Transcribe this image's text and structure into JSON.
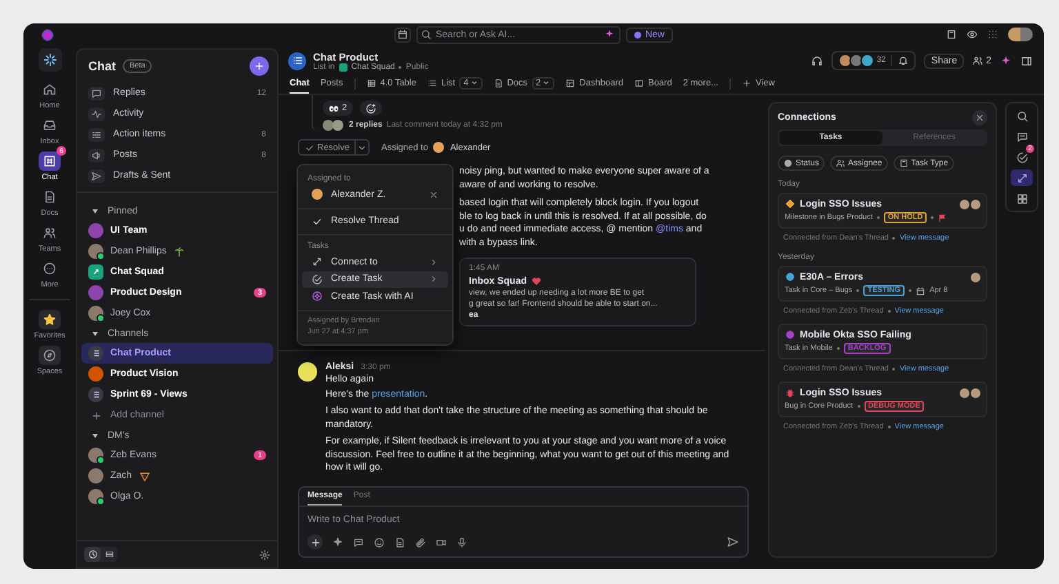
{
  "topbar": {
    "search": {
      "placeholder": "Search or Ask AI..."
    },
    "new_button": "New"
  },
  "rail": {
    "items": [
      {
        "label": "Home",
        "kind": "home",
        "selected": false
      },
      {
        "label": "Inbox",
        "kind": "inbox",
        "selected": false
      },
      {
        "label": "Chat",
        "kind": "chat",
        "selected": true,
        "badge": "6"
      },
      {
        "label": "Docs",
        "kind": "doc",
        "selected": false
      },
      {
        "label": "Teams",
        "kind": "teams",
        "selected": false
      },
      {
        "label": "More",
        "kind": "more",
        "selected": false
      }
    ],
    "bottom_items": [
      {
        "label": "Favorites",
        "kind": "star"
      },
      {
        "label": "Spaces",
        "kind": "compass"
      }
    ]
  },
  "sidebar": {
    "title": "Chat",
    "tag": "Beta",
    "nav": [
      {
        "label": "Replies",
        "kind": "replies",
        "count": "12"
      },
      {
        "label": "Activity",
        "kind": "activity"
      },
      {
        "label": "Action items",
        "kind": "action",
        "count": "8"
      },
      {
        "label": "Posts",
        "kind": "posts",
        "count": "8"
      },
      {
        "label": "Drafts & Sent",
        "kind": "drafts"
      }
    ],
    "sections": [
      {
        "title": "Pinned",
        "expanded": true,
        "items": [
          {
            "label": "UI Team",
            "kind": "team",
            "unread": true,
            "selected": false
          },
          {
            "label": "Dean Phillips",
            "kind": "person",
            "unread": false,
            "online": true,
            "selected": false,
            "status_emoji": {
              "kind": "palm"
            }
          },
          {
            "label": "Chat Squad",
            "kind": "space",
            "unread": true,
            "selected": false
          },
          {
            "label": "Product Design",
            "kind": "team",
            "unread": true,
            "selected": false,
            "badge": "3"
          },
          {
            "label": "Joey Cox",
            "kind": "person",
            "unread": false,
            "online": true,
            "selected": false
          }
        ]
      },
      {
        "title": "Channels",
        "expanded": true,
        "add_label": "Add channel",
        "items": [
          {
            "label": "Chat Product",
            "kind": "channel",
            "unread": true,
            "selected": true
          },
          {
            "label": "Product Vision",
            "kind": "team",
            "unread": true,
            "selected": false
          },
          {
            "label": "Sprint 69 - Views",
            "kind": "channel",
            "unread": true,
            "selected": false
          }
        ]
      },
      {
        "title": "DM's",
        "expanded": true,
        "items": [
          {
            "label": "Zeb Evans",
            "kind": "person",
            "unread": false,
            "online": true,
            "selected": false,
            "badge": "1"
          },
          {
            "label": "Zach",
            "kind": "person",
            "unread": false,
            "online": false,
            "selected": false,
            "status_emoji": {
              "kind": "pizza"
            }
          },
          {
            "label": "Olga O.",
            "kind": "person",
            "unread": false,
            "online": true,
            "selected": false
          }
        ]
      }
    ]
  },
  "header": {
    "title": "Chat Product",
    "location_prefix": "List in",
    "location": "Chat Squad",
    "visibility": "Public",
    "member_count": "32",
    "share": "Share",
    "watchers": "2",
    "tabs": [
      {
        "label": "Chat",
        "kind": "text",
        "selected": true
      },
      {
        "label": "Posts",
        "kind": "text",
        "selected": false
      },
      {
        "label": "4.0 Table",
        "kind": "table",
        "selected": false
      },
      {
        "label": "List",
        "kind": "list",
        "count": "4",
        "selected": false
      },
      {
        "label": "Docs",
        "kind": "doc",
        "count": "2",
        "selected": false
      },
      {
        "label": "Dashboard",
        "kind": "dashboard",
        "selected": false
      },
      {
        "label": "Board",
        "kind": "board",
        "selected": false
      },
      {
        "label": "2 more...",
        "kind": "text",
        "selected": false
      }
    ],
    "add_view": "View"
  },
  "thread": {
    "reactions": [
      {
        "kind": "eyes",
        "count": "2"
      }
    ],
    "replies": "2 replies",
    "last_comment": "Last comment today at 4:32 pm",
    "resolve": "Resolve",
    "assigned_label": "Assigned to",
    "assignee": "Alexander",
    "paragraphs": [
      [
        [
          {
            "kind": "text",
            "text": "noisy ping, but wanted to make everyone super aware of a"
          }
        ],
        [
          {
            "kind": "text",
            "text": "aware of and working to resolve."
          }
        ]
      ],
      [
        [
          {
            "kind": "text",
            "text": "based login that will completely block login. If you logout"
          }
        ],
        [
          {
            "kind": "text",
            "text": "ble to log back in until this is resolved. If at all possible, do"
          }
        ],
        [
          {
            "kind": "text",
            "text": "u do and need immediate access, @ mention "
          },
          {
            "kind": "mention",
            "text": "@tims"
          },
          {
            "kind": "text",
            "text": " and"
          }
        ],
        [
          {
            "kind": "text",
            "text": "with a bypass link."
          }
        ]
      ]
    ],
    "quote": {
      "time": "1:45 AM",
      "title": "Inbox Squad",
      "lines": [
        "view, we ended up needing a lot more BE to get",
        "g great so far! Frontend should be able to start on..."
      ],
      "footer": "ea"
    }
  },
  "menu": {
    "assigned_heading": "Assigned to",
    "assignee": "Alexander Z.",
    "resolve": "Resolve Thread",
    "tasks_heading": "Tasks",
    "items": [
      {
        "label": "Connect to",
        "kind": "connect",
        "submenu": true,
        "selected": false
      },
      {
        "label": "Create Task",
        "kind": "task",
        "submenu": true,
        "selected": true
      },
      {
        "label": "Create Task with AI",
        "kind": "ai",
        "submenu": false,
        "selected": false
      }
    ],
    "assigned_by": "Assigned by Brendan",
    "assigned_at": "Jun 27 at 4:37 pm"
  },
  "message": {
    "author": "Aleksi",
    "time": "3:30 pm",
    "greeting": "Hello again",
    "link_before": "Here's the ",
    "link": "presentation",
    "link_after": ".",
    "paragraphs": [
      "I also want to add that don't take the structure of the meeting as something that should be mandatory.",
      "For example, if Silent feedback is irrelevant to you at your stage and you want more of a voice discussion. Feel free to outline it at the beginning, what you want to get out of this meeting and how it will go."
    ]
  },
  "composer": {
    "tabs": [
      {
        "label": "Message",
        "selected": true
      },
      {
        "label": "Post",
        "selected": false
      }
    ],
    "placeholder": "Write to Chat Product"
  },
  "connections": {
    "title": "Connections",
    "tabs": [
      {
        "label": "Tasks",
        "selected": true
      },
      {
        "label": "References",
        "selected": false
      }
    ],
    "filters": [
      {
        "label": "Status",
        "kind": "status"
      },
      {
        "label": "Assignee",
        "kind": "assignee"
      },
      {
        "label": "Task Type",
        "kind": "type"
      }
    ],
    "groups": [
      {
        "title": "Today",
        "cards": [
          {
            "title": "Login SSO Issues",
            "kind": "milestone",
            "subtitle": "Milestone in Bugs Product",
            "status": "ON HOLD",
            "color": "#e0a33a",
            "flag": true,
            "avatars": [
              {
                "kind": "photo"
              },
              {
                "kind": "photo"
              }
            ],
            "source": "Connected from Dean's Thread",
            "link": "View message"
          }
        ]
      },
      {
        "title": "Yesterday",
        "cards": [
          {
            "title": "E30A – Errors",
            "kind": "task",
            "subtitle": "Task in Core – Bugs",
            "status": "TESTING",
            "color": "#4aa3d8",
            "flag": false,
            "date": "Apr 8",
            "avatars": [
              {
                "kind": "photo"
              }
            ],
            "source": "Connected from Zeb's Thread",
            "link": "View message"
          },
          {
            "title": "Mobile Okta SSO Failing",
            "kind": "mobile",
            "subtitle": "Task in Mobile",
            "status": "BACKLOG",
            "color": "#a640c8",
            "flag": false,
            "source": "Connected from Dean's Thread",
            "link": "View message"
          },
          {
            "title": "Login SSO Issues",
            "kind": "bug",
            "subtitle": "Bug in Core Product",
            "status": "DEBUG MODE",
            "color": "#e0475a",
            "flag": false,
            "avatars": [
              {
                "kind": "photo"
              },
              {
                "kind": "photo"
              }
            ],
            "source": "Connected from Zeb's Thread",
            "link": "View message"
          }
        ]
      }
    ]
  },
  "right_rail": [
    {
      "kind": "search",
      "selected": false
    },
    {
      "kind": "comment",
      "selected": false
    },
    {
      "kind": "check",
      "selected": false,
      "badge": "2"
    },
    {
      "kind": "connect",
      "selected": true
    },
    {
      "kind": "apps",
      "selected": false
    }
  ]
}
